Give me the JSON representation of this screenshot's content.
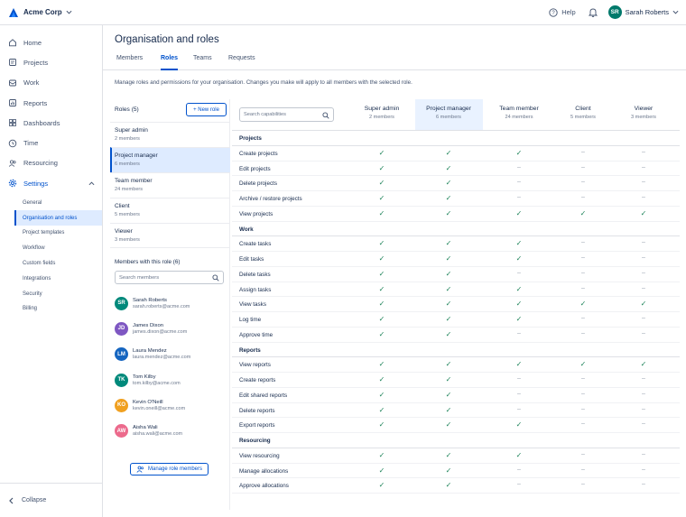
{
  "org": {
    "name": "Acme Corp"
  },
  "topbar": {
    "help_label": "Help",
    "user_name": "Sarah Roberts",
    "user_initials": "SR"
  },
  "sidebar": {
    "items": [
      {
        "label": "Home",
        "icon": "home-icon"
      },
      {
        "label": "Projects",
        "icon": "projects-icon"
      },
      {
        "label": "Work",
        "icon": "work-icon"
      },
      {
        "label": "Reports",
        "icon": "reports-icon"
      },
      {
        "label": "Dashboards",
        "icon": "dashboards-icon"
      },
      {
        "label": "Time",
        "icon": "clock-icon"
      },
      {
        "label": "Resourcing",
        "icon": "people-icon"
      },
      {
        "label": "Settings",
        "icon": "gear-icon"
      }
    ],
    "settings_sub": [
      "General",
      "Organisation and roles",
      "Project templates",
      "Workflow",
      "Custom fields",
      "Integrations",
      "Security",
      "Billing"
    ],
    "collapse_label": "Collapse"
  },
  "page": {
    "title": "Organisation and roles",
    "tabs": [
      "Members",
      "Roles",
      "Teams",
      "Requests"
    ],
    "description": "Manage roles and permissions for your organisation. Changes you make will apply to all members with the selected role."
  },
  "roles_panel": {
    "header": "Roles (5)",
    "new_role_label": "+ New role",
    "roles": [
      {
        "name": "Super admin",
        "count": "2 members"
      },
      {
        "name": "Project manager",
        "count": "6 members"
      },
      {
        "name": "Team member",
        "count": "24 members"
      },
      {
        "name": "Client",
        "count": "5 members"
      },
      {
        "name": "Viewer",
        "count": "3 members"
      }
    ],
    "members_header": "Members with this role (6)",
    "members_search_placeholder": "Search members",
    "members": [
      {
        "initials": "SR",
        "name": "Sarah Roberts",
        "email": "sarah.roberts@acme.com",
        "color": "#00897b"
      },
      {
        "initials": "JD",
        "name": "James Dixon",
        "email": "james.dixon@acme.com",
        "color": "#7e57c2"
      },
      {
        "initials": "LM",
        "name": "Laura Mendez",
        "email": "laura.mendez@acme.com",
        "color": "#1565c0"
      },
      {
        "initials": "TK",
        "name": "Tom Kilby",
        "email": "tom.kilby@acme.com",
        "color": "#00897b"
      },
      {
        "initials": "KO",
        "name": "Kevin O'Neill",
        "email": "kevin.oneill@acme.com",
        "color": "#f0a020"
      },
      {
        "initials": "AW",
        "name": "Aisha Wali",
        "email": "aisha.wali@acme.com",
        "color": "#ec6a8c"
      }
    ],
    "manage_label": "Manage role members"
  },
  "matrix": {
    "search_placeholder": "Search capabilities",
    "columns": [
      {
        "name": "Super admin",
        "count": "2 members"
      },
      {
        "name": "Project manager",
        "count": "6 members"
      },
      {
        "name": "Team member",
        "count": "24 members"
      },
      {
        "name": "Client",
        "count": "5 members"
      },
      {
        "name": "Viewer",
        "count": "3 members"
      }
    ],
    "groups": [
      {
        "name": "Projects",
        "rows": [
          {
            "label": "Create projects",
            "values": [
              1,
              1,
              1,
              0,
              0
            ]
          },
          {
            "label": "Edit projects",
            "values": [
              1,
              1,
              0,
              0,
              0
            ]
          },
          {
            "label": "Delete projects",
            "values": [
              1,
              1,
              0,
              0,
              0
            ]
          },
          {
            "label": "Archive / restore projects",
            "values": [
              1,
              1,
              0,
              0,
              0
            ]
          },
          {
            "label": "View projects",
            "values": [
              1,
              1,
              1,
              1,
              1
            ]
          }
        ]
      },
      {
        "name": "Work",
        "rows": [
          {
            "label": "Create tasks",
            "values": [
              1,
              1,
              1,
              0,
              0
            ]
          },
          {
            "label": "Edit tasks",
            "values": [
              1,
              1,
              1,
              0,
              0
            ]
          },
          {
            "label": "Delete tasks",
            "values": [
              1,
              1,
              0,
              0,
              0
            ]
          },
          {
            "label": "Assign tasks",
            "values": [
              1,
              1,
              1,
              0,
              0
            ]
          },
          {
            "label": "View tasks",
            "values": [
              1,
              1,
              1,
              1,
              1
            ]
          },
          {
            "label": "Log time",
            "values": [
              1,
              1,
              1,
              0,
              0
            ]
          },
          {
            "label": "Approve time",
            "values": [
              1,
              1,
              0,
              0,
              0
            ]
          }
        ]
      },
      {
        "name": "Reports",
        "rows": [
          {
            "label": "View reports",
            "values": [
              1,
              1,
              1,
              1,
              1
            ]
          },
          {
            "label": "Create reports",
            "values": [
              1,
              1,
              0,
              0,
              0
            ]
          },
          {
            "label": "Edit shared reports",
            "values": [
              1,
              1,
              0,
              0,
              0
            ]
          },
          {
            "label": "Delete reports",
            "values": [
              1,
              1,
              0,
              0,
              0
            ]
          },
          {
            "label": "Export reports",
            "values": [
              1,
              1,
              1,
              0,
              0
            ]
          }
        ]
      },
      {
        "name": "Resourcing",
        "rows": [
          {
            "label": "View resourcing",
            "values": [
              1,
              1,
              1,
              0,
              0
            ]
          },
          {
            "label": "Manage allocations",
            "values": [
              1,
              1,
              0,
              0,
              0
            ]
          },
          {
            "label": "Approve allocations",
            "values": [
              1,
              1,
              0,
              0,
              0
            ]
          }
        ]
      }
    ],
    "check_glyph": "✓",
    "dash_glyph": "–"
  },
  "colors": {
    "accent": "#0052cc",
    "check": "#1f845a",
    "selected_bg": "#deebff"
  }
}
